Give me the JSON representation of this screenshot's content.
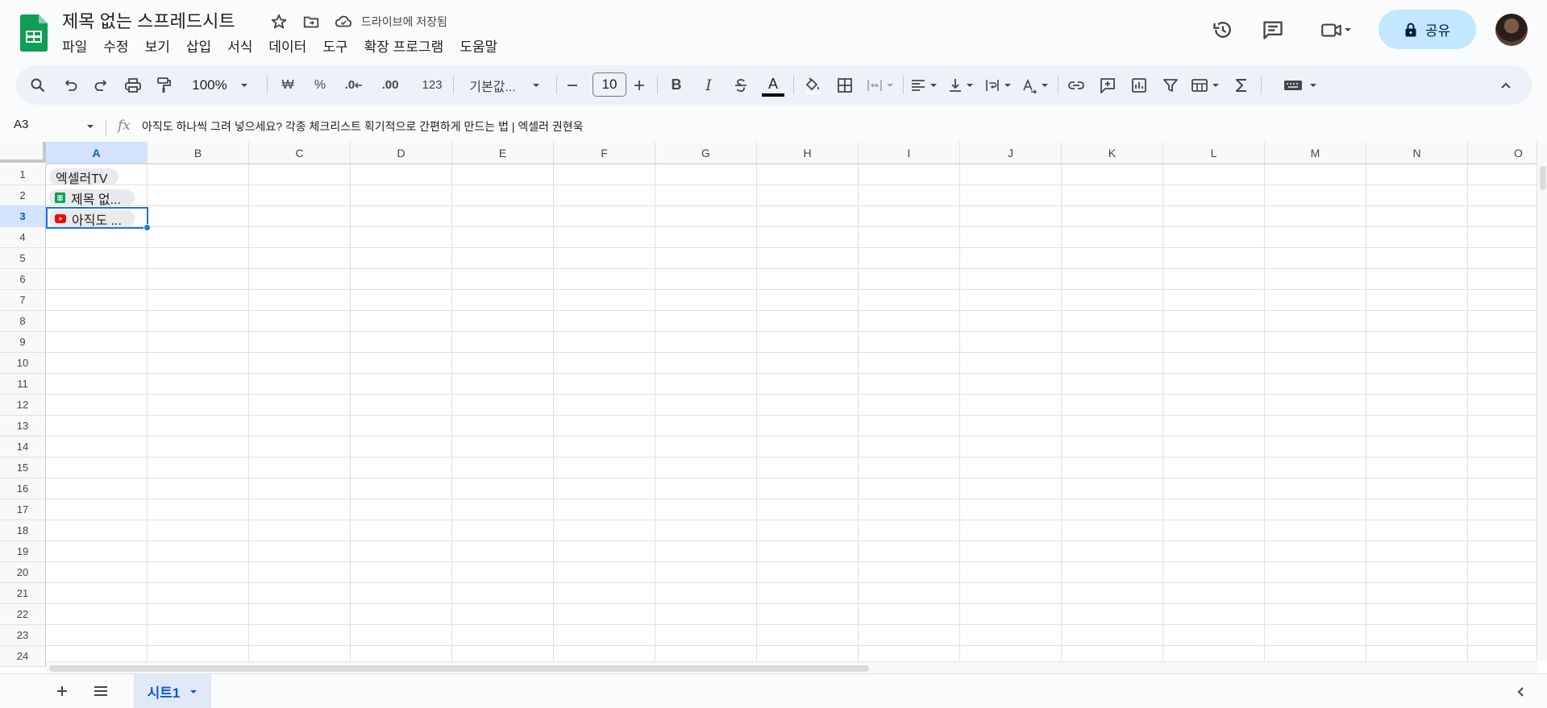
{
  "app": {
    "doc_title": "제목 없는 스프레드시트",
    "saved_status": "드라이브에 저장됨",
    "share_label": "공유"
  },
  "menu": [
    "파일",
    "수정",
    "보기",
    "삽입",
    "서식",
    "데이터",
    "도구",
    "확장 프로그램",
    "도움말"
  ],
  "toolbar": {
    "zoom": "100%",
    "currency": "₩",
    "percent": "%",
    "decrease_decimal": ".0",
    "increase_decimal": ".00",
    "number_format": "123",
    "font_name": "기본값...",
    "font_size": "10",
    "bold": "B",
    "italic": "I",
    "text_color_label": "A",
    "text_color": "#000000"
  },
  "formula_bar": {
    "name_box": "A3",
    "fx": "fx",
    "content": "아직도 하나씩 그려 넣으세요? 각종 체크리스트 획기적으로 간편하게 만드는 법 | 엑셀러 권현욱"
  },
  "grid": {
    "columns": [
      "A",
      "B",
      "C",
      "D",
      "E",
      "F",
      "G",
      "H",
      "I",
      "J",
      "K",
      "L",
      "M",
      "N",
      "O"
    ],
    "rows": [
      "1",
      "2",
      "3",
      "4",
      "5",
      "6",
      "7",
      "8",
      "9",
      "10",
      "11",
      "12",
      "13",
      "14",
      "15",
      "16",
      "17",
      "18",
      "19",
      "20",
      "21",
      "22",
      "23",
      "24"
    ],
    "selected_cell": "A3",
    "cells": {
      "A1": "엑셀러TV",
      "A2": "제목 없...",
      "A3": "아직도 ..."
    }
  },
  "sheets": [
    {
      "label": "시트1",
      "active": true
    }
  ],
  "colors": {
    "accent": "#0b57d0",
    "selection": "#1a73e8",
    "share_bg": "#c2e7ff",
    "sheets_green": "#0f9d58",
    "youtube_red": "#ff0000"
  }
}
